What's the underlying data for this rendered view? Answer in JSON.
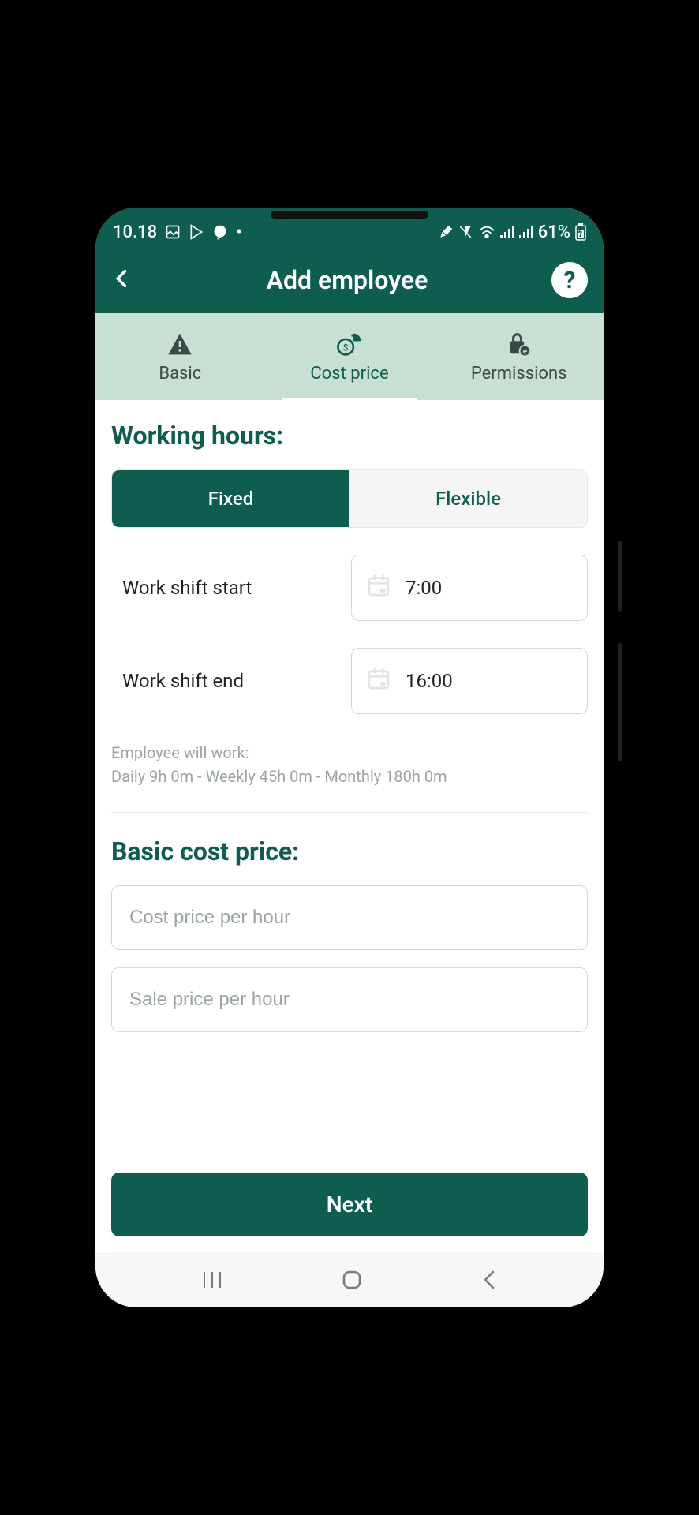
{
  "status": {
    "time": "10.18",
    "battery": "61%"
  },
  "header": {
    "title": "Add employee"
  },
  "tabs": {
    "basic": "Basic",
    "cost": "Cost price",
    "permissions": "Permissions"
  },
  "working_hours": {
    "title": "Working hours:",
    "fixed": "Fixed",
    "flexible": "Flexible",
    "start_label": "Work shift start",
    "start_value": "7:00",
    "end_label": "Work shift end",
    "end_value": "16:00",
    "summary_label": "Employee will work:",
    "summary_value": "Daily 9h 0m - Weekly 45h 0m - Monthly 180h 0m"
  },
  "cost": {
    "title": "Basic cost price:",
    "cost_placeholder": "Cost price per hour",
    "sale_placeholder": "Sale price per hour"
  },
  "next": "Next"
}
